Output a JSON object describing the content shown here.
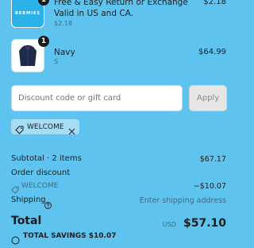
{
  "line_items": [
    {
      "thumb_text": "BERMIES",
      "quantity": "1",
      "title": "Free & Easy Return or Exchange Valid in US and CA.",
      "subtitle": "$2.18",
      "price": "$2.18"
    },
    {
      "quantity": "1",
      "title": "Navy",
      "subtitle": "S",
      "price": "$64.99"
    }
  ],
  "discount": {
    "placeholder": "Discount code or gift card",
    "apply_label": "Apply",
    "applied_code": "WELCOME"
  },
  "summary": {
    "subtotal_label": "Subtotal · 2 items",
    "subtotal_value": "$67.17",
    "order_discount_label": "Order discount",
    "discount_code": "WELCOME",
    "discount_value": "−$10.07",
    "shipping_label": "Shipping",
    "shipping_value": "Enter shipping address",
    "total_label": "Total",
    "currency": "USD",
    "total_value": "$57.10",
    "savings_label": "TOTAL SAVINGS $10.07"
  },
  "colors": {
    "background": "#5fc3ef",
    "thumb_accent": "#2ab1e8",
    "apply_bg": "#e6e6e6"
  }
}
